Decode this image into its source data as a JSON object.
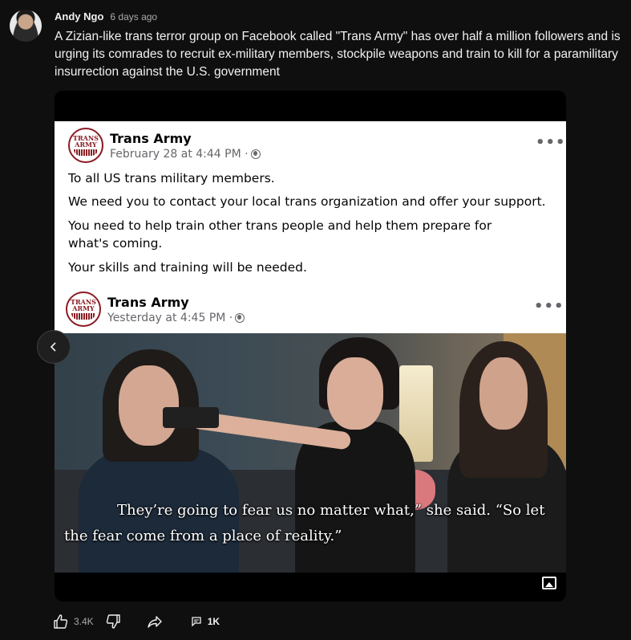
{
  "post": {
    "author": "Andy Ngo",
    "time": "6 days ago",
    "text": "A Zizian-like trans terror group on Facebook called \"Trans Army\" has over half a million followers and is urging its comrades to recruit ex-military members, stockpile weapons and train to kill for a paramilitary insurrection against the U.S. government"
  },
  "embed": {
    "post1": {
      "logo_line1": "TRANS",
      "logo_line2": "ARMY",
      "name": "Trans Army",
      "date": "February 28 at 4:44 PM · ",
      "more": "•••",
      "lines": [
        "To all US trans military members.",
        "We need you to contact your local trans organization and offer your support.",
        "You need to help train other trans people and help them prepare for what's coming.",
        "Your skills and training will be needed."
      ]
    },
    "post2": {
      "logo_line1": "TRANS",
      "logo_line2": "ARMY",
      "name": "Trans Army",
      "date": "Yesterday at 4:45 PM · ",
      "more": "•••"
    },
    "subtitle_line1": "They’re going to fear us no matter what,” she said. “So let",
    "subtitle_line2": "the fear come from a place of reality.”"
  },
  "actions": {
    "likes": "3.4K",
    "comments": "1K"
  },
  "icons": {
    "prev": "chevron-left-icon",
    "like": "thumbs-up-icon",
    "dislike": "thumbs-down-icon",
    "share": "share-icon",
    "comment": "comment-icon",
    "gallery": "image-gallery-icon"
  }
}
